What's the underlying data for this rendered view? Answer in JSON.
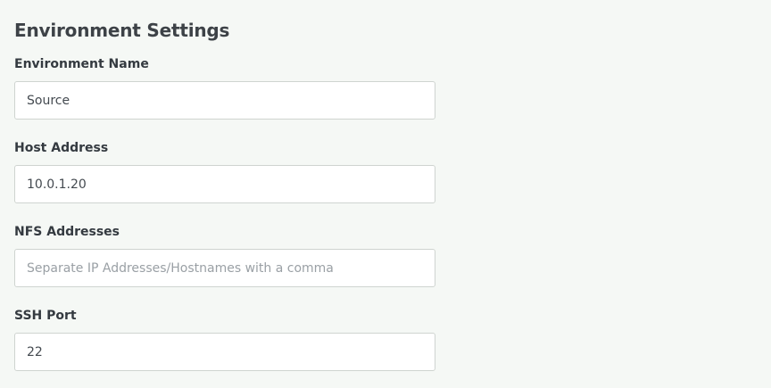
{
  "section": {
    "title": "Environment Settings"
  },
  "fields": {
    "environment_name": {
      "label": "Environment Name",
      "value": "Source",
      "placeholder": ""
    },
    "host_address": {
      "label": "Host Address",
      "value": "10.0.1.20",
      "placeholder": ""
    },
    "nfs_addresses": {
      "label": "NFS Addresses",
      "value": "",
      "placeholder": "Separate IP Addresses/Hostnames with a comma"
    },
    "ssh_port": {
      "label": "SSH Port",
      "value": "22",
      "placeholder": ""
    }
  }
}
